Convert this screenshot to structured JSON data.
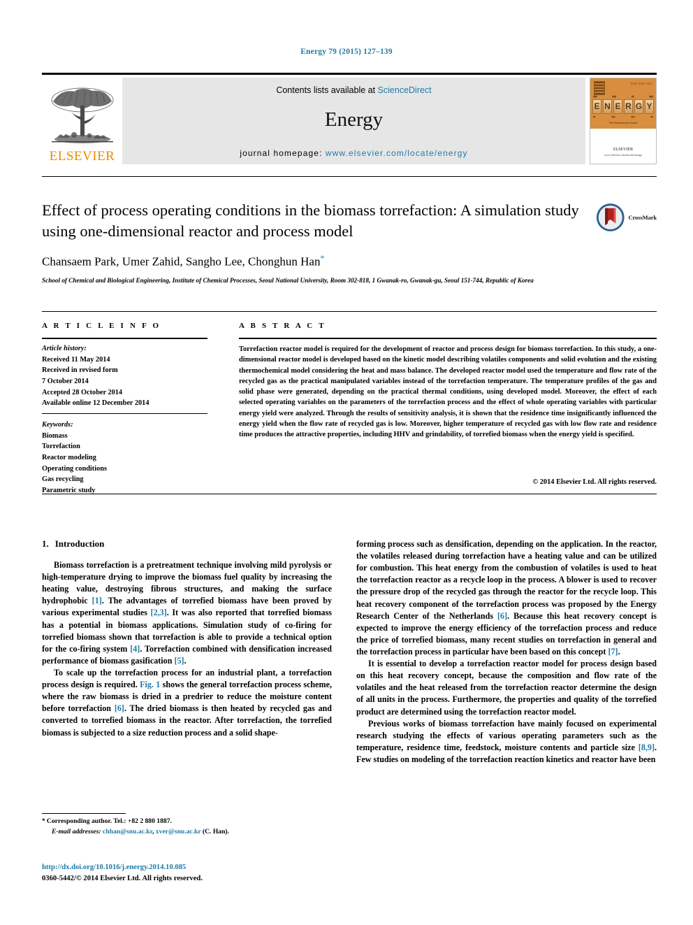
{
  "running_head": "Energy 79 (2015) 127–139",
  "masthead": {
    "publisher_logo_text": "ELSEVIER",
    "contents_prefix": "Contents lists available at ",
    "contents_link": "ScienceDirect",
    "journal_name": "Energy",
    "homepage_prefix": "journal homepage: ",
    "homepage_url": "www.elsevier.com/locate/energy",
    "cover": {
      "wordmark": [
        "E",
        "N",
        "E",
        "R",
        "G",
        "Y"
      ],
      "issn_note": "ISSN 0360-5442",
      "tagline": "The International Journal",
      "publisher": "ELSEVIER",
      "publisher_sub": "www.elsevier.com/locate/energy"
    }
  },
  "article": {
    "title": "Effect of process operating conditions in the biomass torrefaction: A simulation study using one-dimensional reactor and process model",
    "authors": "Chansaem Park, Umer Zahid, Sangho Lee, Chonghun Han",
    "corresponding_marker": "*",
    "affiliation": "School of Chemical and Biological Engineering, Institute of Chemical Processes, Seoul National University, Room 302-818, 1 Gwanak-ro, Gwanak-gu, Seoul 151-744, Republic of Korea",
    "crossmark_label": "CrossMark"
  },
  "panel": {
    "info_heading": "A R T I C L E   I N F O",
    "abstract_heading": "A B S T R A C T",
    "history_label": "Article history:",
    "history_lines": [
      "Received 11 May 2014",
      "Received in revised form",
      "7 October 2014",
      "Accepted 28 October 2014",
      "Available online 12 December 2014"
    ],
    "keywords_label": "Keywords:",
    "keywords": [
      "Biomass",
      "Torrefaction",
      "Reactor modeling",
      "Operating conditions",
      "Gas recycling",
      "Parametric study"
    ],
    "abstract": "Torrefaction reactor model is required for the development of reactor and process design for biomass torrefaction. In this study, a one-dimensional reactor model is developed based on the kinetic model describing volatiles components and solid evolution and the existing thermochemical model considering the heat and mass balance. The developed reactor model used the temperature and flow rate of the recycled gas as the practical manipulated variables instead of the torrefaction temperature. The temperature profiles of the gas and solid phase were generated, depending on the practical thermal conditions, using developed model. Moreover, the effect of each selected operating variables on the parameters of the torrefaction process and the effect of whole operating variables with particular energy yield were analyzed. Through the results of sensitivity analysis, it is shown that the residence time insignificantly influenced the energy yield when the flow rate of recycled gas is low. Moreover, higher temperature of recycled gas with low flow rate and residence time produces the attractive properties, including HHV and grindability, of torrefied biomass when the energy yield is specified.",
    "copyright": "© 2014 Elsevier Ltd. All rights reserved."
  },
  "body": {
    "section_number": "1.",
    "section_title": "Introduction",
    "left_paragraphs": [
      {
        "parts": [
          {
            "t": "Biomass torrefaction is a pretreatment technique involving mild pyrolysis or high-temperature drying to improve the biomass fuel quality by increasing the heating value, destroying fibrous structures, and making the surface hydrophobic "
          },
          {
            "t": "[1]",
            "ref": true
          },
          {
            "t": ". The advantages of torrefied biomass have been proved by various experimental studies "
          },
          {
            "t": "[2,3]",
            "ref": true
          },
          {
            "t": ". It was also reported that torrefied biomass has a potential in biomass applications. Simulation study of co-firing for torrefied biomass shown that torrefaction is able to provide a technical option for the co-firing system "
          },
          {
            "t": "[4]",
            "ref": true
          },
          {
            "t": ". Torrefaction combined with densification increased performance of biomass gasification "
          },
          {
            "t": "[5]",
            "ref": true
          },
          {
            "t": "."
          }
        ]
      },
      {
        "parts": [
          {
            "t": "To scale up the torrefaction process for an industrial plant, a torrefaction process design is required. "
          },
          {
            "t": "Fig. 1",
            "ref": true
          },
          {
            "t": " shows the general torrefaction process scheme, where the raw biomass is dried in a predrier to reduce the moisture content before torrefaction "
          },
          {
            "t": "[6]",
            "ref": true
          },
          {
            "t": ". The dried biomass is then heated by recycled gas and converted to torrefied biomass in the reactor. After torrefaction, the torrefied biomass is subjected to a size reduction process and a solid shape-"
          }
        ]
      }
    ],
    "right_paragraphs": [
      {
        "continued": true,
        "parts": [
          {
            "t": "forming process such as densification, depending on the application. In the reactor, the volatiles released during torrefaction have a heating value and can be utilized for combustion. This heat energy from the combustion of volatiles is used to heat the torrefaction reactor as a recycle loop in the process. A blower is used to recover the pressure drop of the recycled gas through the reactor for the recycle loop. This heat recovery component of the torrefaction process was proposed by the Energy Research Center of the Netherlands "
          },
          {
            "t": "[6]",
            "ref": true
          },
          {
            "t": ". Because this heat recovery concept is expected to improve the energy efficiency of the torrefaction process and reduce the price of torrefied biomass, many recent studies on torrefaction in general and the torrefaction process in particular have been based on this concept "
          },
          {
            "t": "[7]",
            "ref": true
          },
          {
            "t": "."
          }
        ]
      },
      {
        "parts": [
          {
            "t": "It is essential to develop a torrefaction reactor model for process design based on this heat recovery concept, because the composition and flow rate of the volatiles and the heat released from the torrefaction reactor determine the design of all units in the process. Furthermore, the properties and quality of the torrefied product are determined using the torrefaction reactor model."
          }
        ]
      },
      {
        "parts": [
          {
            "t": "Previous works of biomass torrefaction have mainly focused on experimental research studying the effects of various operating parameters such as the temperature, residence time, feedstock, moisture contents and particle size "
          },
          {
            "t": "[8,9]",
            "ref": true
          },
          {
            "t": ". Few studies on modeling of the torrefaction reaction kinetics and reactor have been"
          }
        ]
      }
    ]
  },
  "footer": {
    "corresponding_marker": "*",
    "corresponding_text": "Corresponding author. Tel.: +82 2 880 1887.",
    "email_label": "E-mail addresses:",
    "email_1": "chhan@snu.ac.kr",
    "email_2": "xver@snu.ac.kr",
    "email_suffix": "(C. Han).",
    "doi": "http://dx.doi.org/10.1016/j.energy.2014.10.085",
    "issn_line": "0360-5442/© 2014 Elsevier Ltd. All rights reserved."
  },
  "colors": {
    "link": "#1f7aa8",
    "elsevier_orange": "#ED8B00",
    "band_gray": "#e6e6e6",
    "crossmark_red": "#c0392b"
  }
}
